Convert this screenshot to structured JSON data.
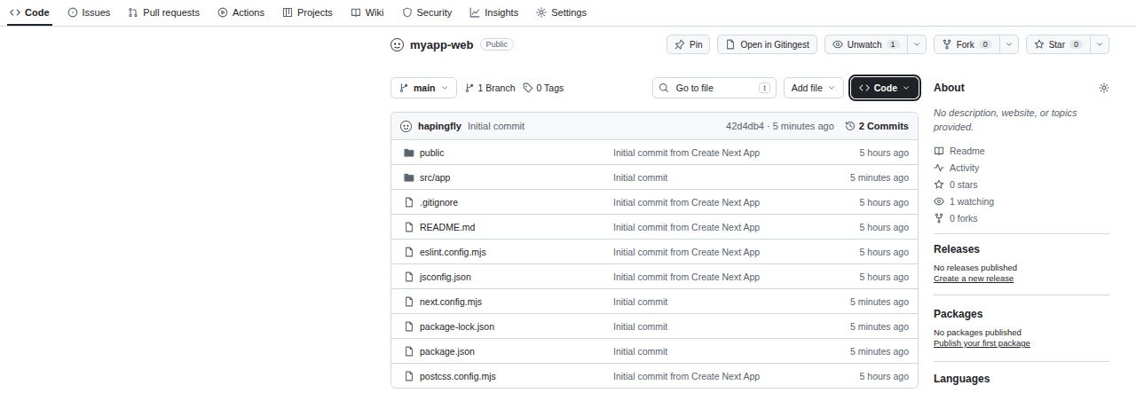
{
  "nav": {
    "tabs": [
      {
        "label": "Code",
        "selected": true
      },
      {
        "label": "Issues",
        "selected": false
      },
      {
        "label": "Pull requests",
        "selected": false
      },
      {
        "label": "Actions",
        "selected": false
      },
      {
        "label": "Projects",
        "selected": false
      },
      {
        "label": "Wiki",
        "selected": false
      },
      {
        "label": "Security",
        "selected": false
      },
      {
        "label": "Insights",
        "selected": false
      },
      {
        "label": "Settings",
        "selected": false
      }
    ]
  },
  "repo": {
    "name": "myapp-web",
    "visibility": "Public",
    "pin": "Pin",
    "gitingest": "Open in Gitingest",
    "watch": {
      "label": "Unwatch",
      "count": "1"
    },
    "fork": {
      "label": "Fork",
      "count": "0"
    },
    "star": {
      "label": "Star",
      "count": "0"
    }
  },
  "toolbar": {
    "branch": "main",
    "branches": "1 Branch",
    "tags": "0 Tags",
    "search": {
      "placeholder": "Go to file",
      "shortcut": "t"
    },
    "add_file": "Add file",
    "code": {
      "label": "Code",
      "focused": true
    }
  },
  "commit": {
    "author": "hapingfly",
    "message": "Initial commit",
    "hash": "42d4db4",
    "separator": "·",
    "time": "5 minutes ago",
    "commits": "2 Commits"
  },
  "files": [
    {
      "name": "public",
      "kind": "folder",
      "message": "Initial commit from Create Next App",
      "time": "5 hours ago"
    },
    {
      "name": "src/app",
      "kind": "folder",
      "message": "Initial commit",
      "time": "5 minutes ago"
    },
    {
      "name": ".gitignore",
      "kind": "file",
      "message": "Initial commit from Create Next App",
      "time": "5 hours ago"
    },
    {
      "name": "README.md",
      "kind": "file",
      "message": "Initial commit from Create Next App",
      "time": "5 hours ago"
    },
    {
      "name": "eslint.config.mjs",
      "kind": "file",
      "message": "Initial commit from Create Next App",
      "time": "5 hours ago"
    },
    {
      "name": "jsconfig.json",
      "kind": "file",
      "message": "Initial commit from Create Next App",
      "time": "5 hours ago"
    },
    {
      "name": "next.config.mjs",
      "kind": "file",
      "message": "Initial commit",
      "time": "5 minutes ago"
    },
    {
      "name": "package-lock.json",
      "kind": "file",
      "message": "Initial commit",
      "time": "5 minutes ago"
    },
    {
      "name": "package.json",
      "kind": "file",
      "message": "Initial commit",
      "time": "5 minutes ago"
    },
    {
      "name": "postcss.config.mjs",
      "kind": "file",
      "message": "Initial commit from Create Next App",
      "time": "5 hours ago"
    }
  ],
  "sidebar": {
    "about": {
      "title": "About",
      "description": "No description, website, or topics provided.",
      "links": [
        "Readme",
        "Activity",
        "0 stars",
        "1 watching",
        "0 forks"
      ]
    },
    "releases": {
      "title": "Releases",
      "note": "No releases published",
      "link": "Create a new release"
    },
    "packages": {
      "title": "Packages",
      "note": "No packages published",
      "link": "Publish your first package"
    },
    "languages": {
      "title": "Languages"
    }
  }
}
